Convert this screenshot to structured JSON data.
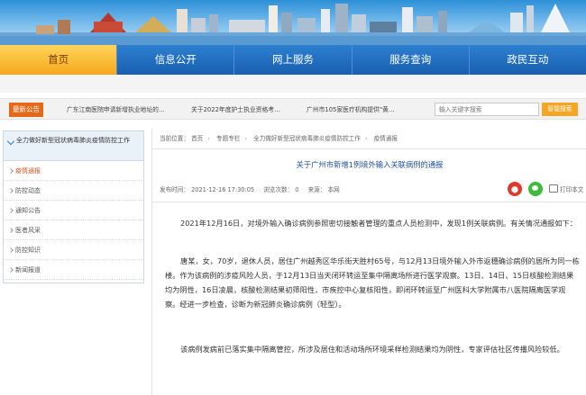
{
  "nav": {
    "items": [
      "首页",
      "信息公开",
      "网上服务",
      "服务查询",
      "政民互动"
    ]
  },
  "notice": {
    "badge": "最新公告",
    "items": [
      "广东江南医院申请新增执业地址的…",
      "关于2022年度护士执业资格考…",
      "广州市105家医疗机构提供\"黄…"
    ]
  },
  "search": {
    "placeholder": "输入关键字搜索",
    "button_label": "智能搜索"
  },
  "sidebar": {
    "title": "全力做好新型冠状病毒肺炎疫情防控工作",
    "items": [
      "疫情通报",
      "防控动态",
      "通知公告",
      "医者风采",
      "防控知识",
      "新闻报道"
    ]
  },
  "breadcrumb": {
    "prefix": "当前位置：",
    "items": [
      "首页",
      "专题专栏",
      "全力做好新型冠状病毒肺炎疫情防控工作",
      "疫情通报"
    ]
  },
  "article": {
    "title": "关于广州市新增1例境外输入关联病例的通报",
    "meta": {
      "published": "发布时间： 2021-12-16 17:30:05",
      "views": "浏览次数： 0",
      "source": "来源： 本网"
    },
    "print_label": "打印本文",
    "paragraphs": [
      "2021年12月16日，对境外输入确诊病例参照密切接触者管理的重点人员检测中，发现1例关联病例。有关情况通报如下：",
      "唐某，女，70岁，退休人员，居住广州越秀区华乐街天胜村65号，与12月13日境外输入外市返穗确诊病例的居所为同一栋楼。作为该病例的涉疫风险人员，于12月13日当天闭环转运至集中隔离场所进行医学观察。13日、14日、15日核酸检测结果均为阴性，16日凌晨，核酸检测结果初筛阳性，市疾控中心复核阳性，即闭环转运至广州医科大学附属市八医院隔离医学观察。经进一步检查，诊断为新冠肺炎确诊病例（轻型）。",
      "该病例发病前已落实集中隔离管控，所涉及居住和活动场所环境采样检测结果均为阴性，专家评估社区传播风险较低。"
    ]
  }
}
